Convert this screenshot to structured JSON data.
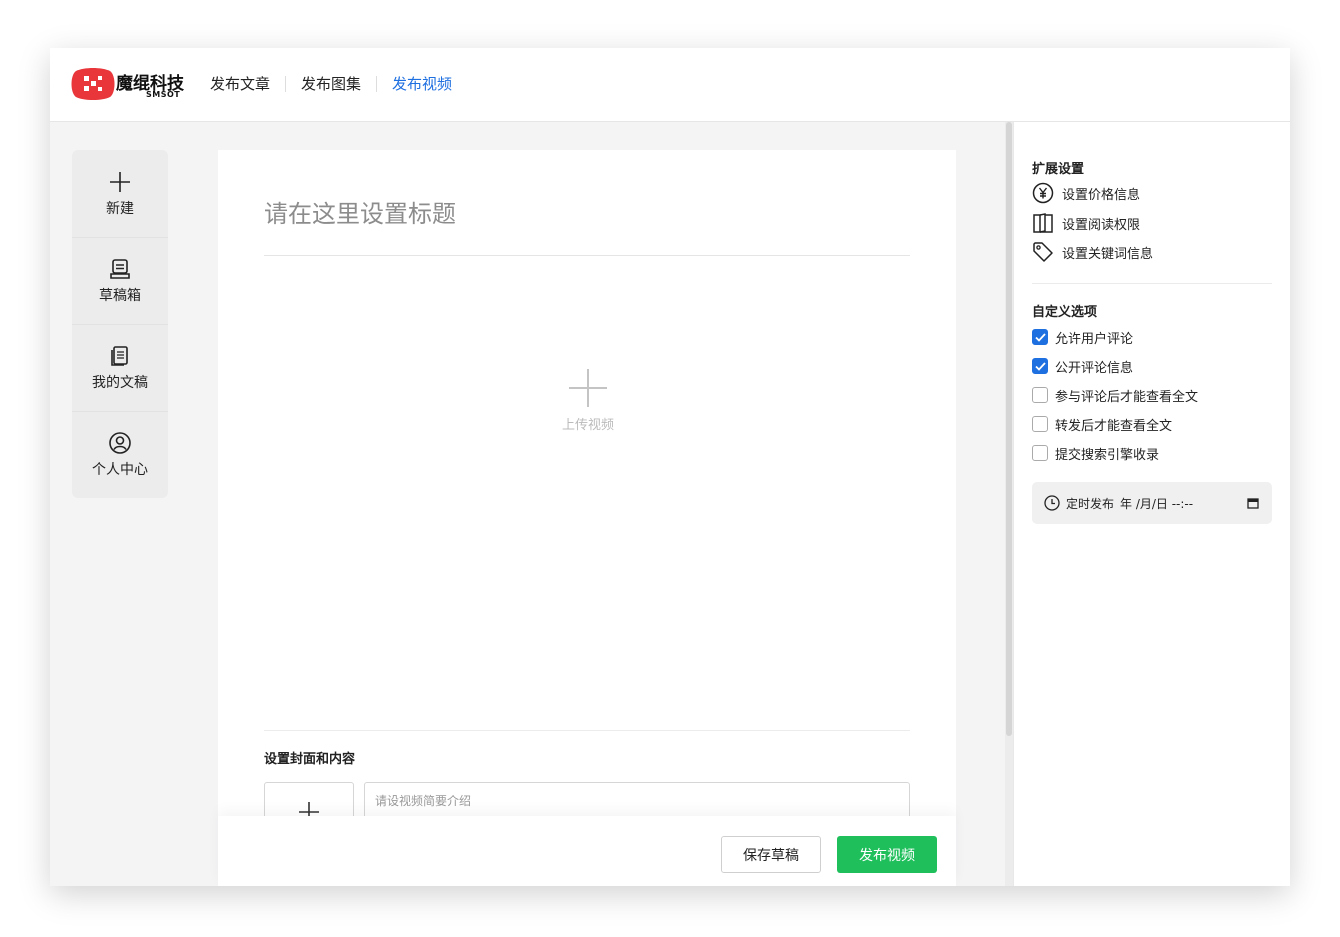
{
  "brand": {
    "name": "魔绲科技",
    "sub": "SMSOT",
    "accent": "#e8363a"
  },
  "nav": {
    "tabs": [
      {
        "label": "发布文章"
      },
      {
        "label": "发布图集"
      },
      {
        "label": "发布视频"
      }
    ],
    "active_color": "#1e6fe0"
  },
  "sidebar": {
    "items": [
      {
        "label": "新建",
        "icon": "plus-icon"
      },
      {
        "label": "草稿箱",
        "icon": "drafts-icon"
      },
      {
        "label": "我的文稿",
        "icon": "documents-icon"
      },
      {
        "label": "个人中心",
        "icon": "user-circle-icon"
      }
    ]
  },
  "editor": {
    "title_placeholder": "请在这里设置标题",
    "upload_label": "上传视频",
    "section_title": "设置封面和内容",
    "intro_placeholder": "请设视频简要介绍"
  },
  "footer": {
    "save_label": "保存草稿",
    "publish_label": "发布视频",
    "publish_color": "#1fbf5c"
  },
  "right": {
    "ext_title": "扩展设置",
    "ext_items": [
      {
        "label": "设置价格信息",
        "icon": "yen-icon"
      },
      {
        "label": "设置阅读权限",
        "icon": "book-icon"
      },
      {
        "label": "设置关键词信息",
        "icon": "tag-icon"
      }
    ],
    "custom_title": "自定义选项",
    "options": [
      {
        "label": "允许用户评论",
        "checked": true
      },
      {
        "label": "公开评论信息",
        "checked": true
      },
      {
        "label": "参与评论后才能查看全文",
        "checked": false
      },
      {
        "label": "转发后才能查看全文",
        "checked": false
      },
      {
        "label": "提交搜索引擎收录",
        "checked": false
      }
    ],
    "schedule_label": "定时发布",
    "schedule_value": "年 /月/日 --:--"
  }
}
